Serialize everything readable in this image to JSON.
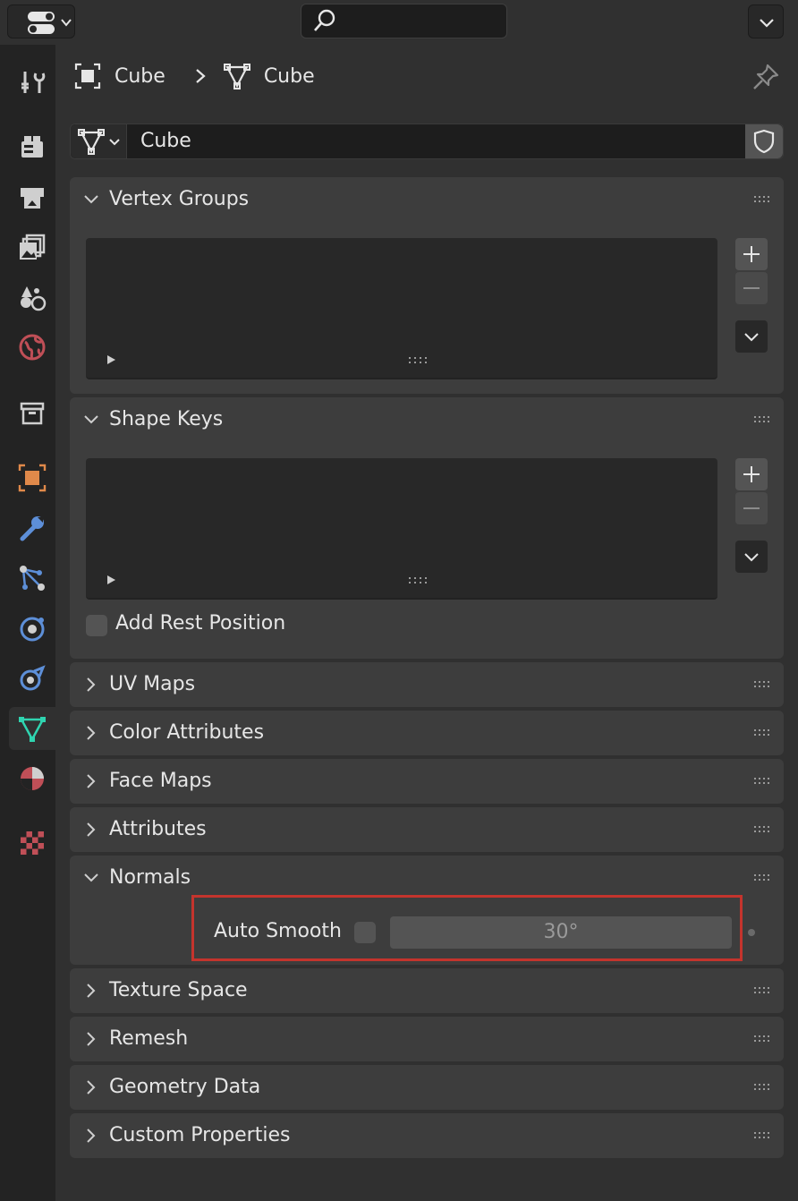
{
  "breadcrumb": {
    "object_name": "Cube",
    "mesh_name": "Cube"
  },
  "datablock": {
    "name": "Cube"
  },
  "tabs": [
    {
      "name": "tool-tab",
      "icon": "tool-icon"
    },
    {
      "name": "render-tab",
      "icon": "render-icon"
    },
    {
      "name": "output-tab",
      "icon": "output-icon"
    },
    {
      "name": "view-layer-tab",
      "icon": "view-layer-icon"
    },
    {
      "name": "scene-tab",
      "icon": "scene-icon"
    },
    {
      "name": "world-tab",
      "icon": "world-icon"
    },
    {
      "name": "collection-tab",
      "icon": "collection-icon"
    },
    {
      "name": "object-tab",
      "icon": "object-icon"
    },
    {
      "name": "modifiers-tab",
      "icon": "wrench-icon"
    },
    {
      "name": "particles-tab",
      "icon": "particles-icon"
    },
    {
      "name": "physics-tab",
      "icon": "physics-icon"
    },
    {
      "name": "constraints-tab",
      "icon": "constraints-icon"
    },
    {
      "name": "data-tab",
      "icon": "mesh-data-icon",
      "active": true
    },
    {
      "name": "material-tab",
      "icon": "material-icon"
    },
    {
      "name": "texture-tab",
      "icon": "texture-icon"
    }
  ],
  "panels": {
    "vertex_groups": "Vertex Groups",
    "shape_keys": "Shape Keys",
    "add_rest_position": "Add Rest Position",
    "uv_maps": "UV Maps",
    "color_attributes": "Color Attributes",
    "face_maps": "Face Maps",
    "attributes": "Attributes",
    "normals": "Normals",
    "auto_smooth": "Auto Smooth",
    "auto_smooth_angle": "30°",
    "texture_space": "Texture Space",
    "remesh": "Remesh",
    "geometry_data": "Geometry Data",
    "custom_properties": "Custom Properties"
  },
  "colors": {
    "accent_data": "#2fd4b0",
    "highlight": "#c4342d",
    "object_orange": "#e0894a",
    "modifier_blue": "#5d8fd8",
    "world_red": "#c04f57"
  }
}
